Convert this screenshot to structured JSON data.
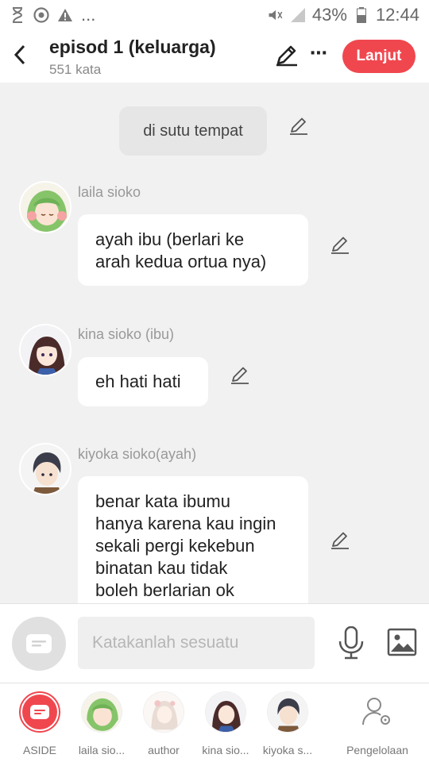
{
  "status_bar": {
    "battery": "43%",
    "time": "12:44",
    "ellipsis": "...",
    "icons": [
      "hourglass-icon",
      "chrome-icon",
      "warning-icon",
      "mute-icon",
      "signal-icon",
      "battery-icon"
    ]
  },
  "header": {
    "title": "episod 1 (keluarga)",
    "word_count": "551 kata",
    "more": "⋯",
    "next_label": "Lanjut",
    "accent": "#f0474f"
  },
  "chat": {
    "narration": "di sutu tempat",
    "messages": [
      {
        "sender": "laila sioko",
        "lines": [
          "ayah ibu (berlari ke",
          "arah kedua ortua nya)"
        ]
      },
      {
        "sender": "kina sioko (ibu)",
        "lines": [
          "eh hati hati"
        ]
      },
      {
        "sender": "kiyoka sioko(ayah)",
        "lines": [
          "benar kata ibumu",
          "hanya karena kau ingin",
          "sekali pergi kekebun",
          "binatan kau tidak",
          "boleh berlarian ok"
        ]
      }
    ]
  },
  "input": {
    "placeholder": "Katakanlah sesuatu"
  },
  "characters": [
    {
      "label": "ASIDE"
    },
    {
      "label": "laila sio..."
    },
    {
      "label": "author"
    },
    {
      "label": "kina sio..."
    },
    {
      "label": "kiyoka s..."
    },
    {
      "label": "Pengelolaan"
    }
  ]
}
